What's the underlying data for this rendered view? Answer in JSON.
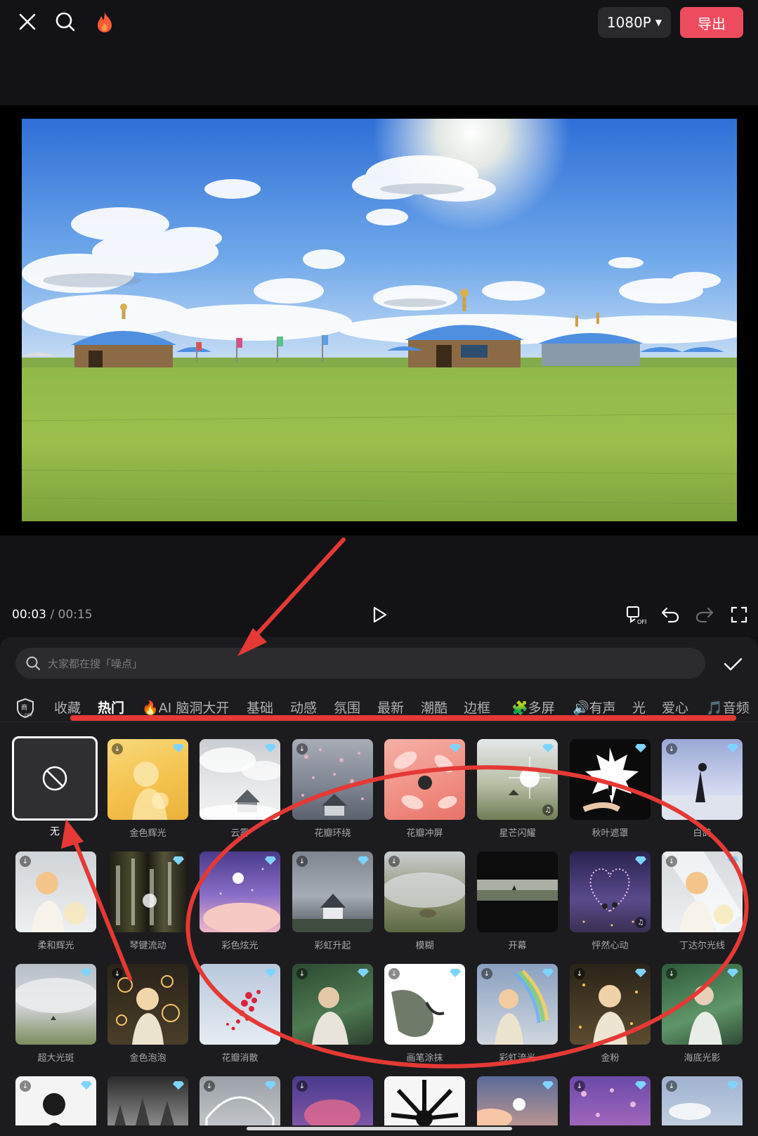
{
  "topbar": {
    "close_icon": "close-icon",
    "search_icon": "search-icon",
    "hot_icon": "flame-icon",
    "resolution": "1080P",
    "export_label": "导出"
  },
  "player": {
    "current_time": "00:03",
    "separator": " / ",
    "total_time": "00:15"
  },
  "search": {
    "placeholder": "大家都在搜「噪点」"
  },
  "categories": [
    {
      "label": "收藏"
    },
    {
      "label": "热门",
      "active": true
    },
    {
      "emoji": "🔥",
      "label": "AI 脑洞大开"
    },
    {
      "label": "基础"
    },
    {
      "label": "动感"
    },
    {
      "label": "氛围"
    },
    {
      "label": "最新"
    },
    {
      "label": "潮酷"
    },
    {
      "label": "边框"
    },
    {
      "emoji": "🧩",
      "label": "多屏"
    },
    {
      "emoji": "🔊",
      "label": "有声"
    },
    {
      "label": "光"
    },
    {
      "label": "爱心"
    },
    {
      "emoji": "🎵",
      "label": "音频"
    }
  ],
  "effects": {
    "none_label": "无",
    "row1": [
      "金色辉光",
      "云雾",
      "花瓣环绕",
      "花瓣冲屏",
      "星芒闪耀",
      "秋叶遮罩",
      "白鸽"
    ],
    "row2": [
      "柔和辉光",
      "琴键流动",
      "彩色炫光",
      "彩虹升起",
      "模糊",
      "开幕",
      "怦然心动",
      "丁达尔光线"
    ],
    "row3": [
      "超大光斑",
      "金色泡泡",
      "花瓣消散",
      "",
      "画笔涂抹",
      "彩虹流光",
      "金粉",
      "海底光影"
    ]
  },
  "colors": {
    "accent_red": "#ef4b5f",
    "annotation_red": "#e53935"
  }
}
